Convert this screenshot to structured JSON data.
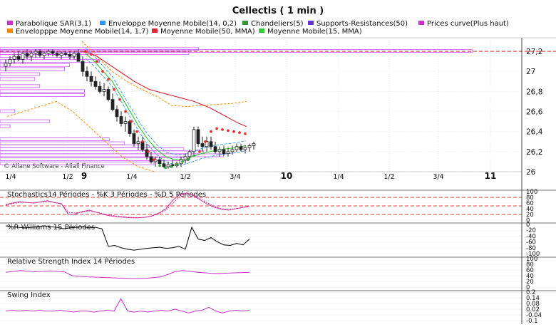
{
  "window": {
    "title": "Cellectis  ( 1 min )",
    "watermark": "© Aliane Software - Aliali Finance"
  },
  "legend": [
    {
      "label": "Parabolique SAR(3,1)",
      "color": "#cc33cc"
    },
    {
      "label": "Enveloppe Moyenne Mobile(14, 0,2)",
      "color": "#3399ff"
    },
    {
      "label": "Chandeliers(5)",
      "color": "#339933"
    },
    {
      "label": "Supports-Resistances(50)",
      "color": "#6633cc"
    },
    {
      "label": "Prices curve(Plus haut)",
      "color": "#cc33cc"
    },
    {
      "label": "Envelopppe Moyenne Mobile(14, 1,7)",
      "color": "#ff8800"
    },
    {
      "label": "Moyenne Mobile(50, MMA)",
      "color": "#dd2233"
    },
    {
      "label": "Moyenne Mobile(15, MMA)",
      "color": "#33cc33"
    }
  ],
  "colors": {
    "candle_up": "#ffffff",
    "candle_down": "#222222",
    "sr_bars": "#cc66ff",
    "sar_dots": "#ee2222",
    "stoch": "#cc3399",
    "williams": "#000000",
    "rsi": "#cc33cc",
    "swing": "#cc33cc",
    "ref_line": "#cc0000"
  },
  "chart_data": [
    {
      "type": "candlestick",
      "title": "Cellectis  ( 1 min )",
      "ylim": [
        26,
        27.3
      ],
      "y_ticks": [
        "27,2",
        "27",
        "26,8",
        "26,6",
        "26,4",
        "26,2",
        "26"
      ],
      "x_ticks": [
        "1/4",
        "1/2",
        "9",
        "1/4",
        "1/2",
        "3/4",
        "10",
        "1/4",
        "1/2",
        "3/4",
        "11"
      ],
      "resistance_line": 27.2,
      "candles_ohlc": [
        [
          27.05,
          27.12,
          27.0,
          27.08
        ],
        [
          27.08,
          27.15,
          27.05,
          27.12
        ],
        [
          27.12,
          27.18,
          27.08,
          27.15
        ],
        [
          27.15,
          27.2,
          27.1,
          27.12
        ],
        [
          27.12,
          27.2,
          27.08,
          27.18
        ],
        [
          27.18,
          27.22,
          27.12,
          27.15
        ],
        [
          27.15,
          27.2,
          27.1,
          27.18
        ],
        [
          27.18,
          27.22,
          27.14,
          27.2
        ],
        [
          27.2,
          27.22,
          27.14,
          27.16
        ],
        [
          27.16,
          27.2,
          27.12,
          27.18
        ],
        [
          27.18,
          27.22,
          27.15,
          27.2
        ],
        [
          27.2,
          27.22,
          27.15,
          27.18
        ],
        [
          27.18,
          27.2,
          27.14,
          27.16
        ],
        [
          27.16,
          27.2,
          27.12,
          27.18
        ],
        [
          27.18,
          27.2,
          27.15,
          27.17
        ],
        [
          27.17,
          27.2,
          27.12,
          27.15
        ],
        [
          27.15,
          27.2,
          27.12,
          27.18
        ],
        [
          27.18,
          27.22,
          27.12,
          27.1
        ],
        [
          27.1,
          27.15,
          26.95,
          27.0
        ],
        [
          27.0,
          27.05,
          26.9,
          26.95
        ],
        [
          26.95,
          27.0,
          26.85,
          26.9
        ],
        [
          26.9,
          26.95,
          26.82,
          26.85
        ],
        [
          26.85,
          26.9,
          26.78,
          26.8
        ],
        [
          26.8,
          26.88,
          26.75,
          26.82
        ],
        [
          26.82,
          26.85,
          26.7,
          26.72
        ],
        [
          26.72,
          26.78,
          26.6,
          26.62
        ],
        [
          26.62,
          26.66,
          26.5,
          26.55
        ],
        [
          26.55,
          26.6,
          26.45,
          26.48
        ],
        [
          26.48,
          26.55,
          26.4,
          26.5
        ],
        [
          26.5,
          26.52,
          26.35,
          26.38
        ],
        [
          26.38,
          26.42,
          26.25,
          26.28
        ],
        [
          26.28,
          26.35,
          26.22,
          26.3
        ],
        [
          26.3,
          26.35,
          26.2,
          26.22
        ],
        [
          26.22,
          26.28,
          26.12,
          26.15
        ],
        [
          26.15,
          26.2,
          26.08,
          26.1
        ],
        [
          26.1,
          26.15,
          26.05,
          26.12
        ],
        [
          26.12,
          26.15,
          26.05,
          26.08
        ],
        [
          26.08,
          26.12,
          26.04,
          26.05
        ],
        [
          26.05,
          26.1,
          26.03,
          26.07
        ],
        [
          26.07,
          26.12,
          26.04,
          26.06
        ],
        [
          26.06,
          26.1,
          26.04,
          26.08
        ],
        [
          26.08,
          26.15,
          26.05,
          26.12
        ],
        [
          26.12,
          26.18,
          26.08,
          26.15
        ],
        [
          26.15,
          26.22,
          26.12,
          26.2
        ],
        [
          26.2,
          26.45,
          26.18,
          26.42
        ],
        [
          26.42,
          26.45,
          26.25,
          26.28
        ],
        [
          26.28,
          26.35,
          26.2,
          26.25
        ],
        [
          26.25,
          26.35,
          26.2,
          26.3
        ],
        [
          26.3,
          26.35,
          26.22,
          26.25
        ],
        [
          26.25,
          26.3,
          26.18,
          26.2
        ],
        [
          26.2,
          26.25,
          26.15,
          26.22
        ],
        [
          26.22,
          26.26,
          26.16,
          26.18
        ],
        [
          26.18,
          26.24,
          26.15,
          26.2
        ],
        [
          26.2,
          26.26,
          26.17,
          26.22
        ],
        [
          26.22,
          26.28,
          26.2,
          26.25
        ],
        [
          26.25,
          26.28,
          26.2,
          26.22
        ],
        [
          26.22,
          26.26,
          26.18,
          26.24
        ],
        [
          26.24,
          26.28,
          26.2,
          26.26
        ],
        [
          26.26,
          26.3,
          26.22,
          26.28
        ]
      ],
      "ma50": [
        27.2,
        27.18,
        27.15,
        27.1,
        27.05,
        27.0,
        26.95,
        26.9,
        26.86,
        26.82,
        26.8,
        26.78,
        26.76,
        26.74,
        26.72,
        26.7,
        26.67,
        26.64,
        26.6,
        26.56,
        26.52,
        26.48,
        26.45
      ],
      "ma15": [
        27.18,
        27.1,
        27.0,
        26.9,
        26.75,
        26.6,
        26.45,
        26.32,
        26.22,
        26.15,
        26.12,
        26.12,
        26.15,
        26.18,
        26.2,
        26.22,
        26.23,
        26.24,
        26.26
      ],
      "envelope_upper_17": [
        27.3,
        27.15,
        27.0,
        26.9,
        26.82,
        26.75,
        26.66,
        26.65,
        26.66,
        26.67,
        26.68,
        26.7
      ],
      "envelope_lower_17": [
        26.55,
        26.6,
        26.65,
        26.7,
        26.6,
        26.45,
        26.3,
        26.15,
        26.05,
        26.0
      ],
      "sar": [
        27.2,
        27.17,
        27.1,
        27.0,
        26.92,
        26.82,
        26.72,
        26.6,
        26.5,
        26.4,
        26.3,
        26.2,
        26.12,
        26.06,
        26.04,
        26.05,
        26.07,
        26.1,
        26.12,
        26.16,
        26.2,
        26.3,
        26.4,
        26.43,
        26.42,
        26.41,
        26.4,
        26.39,
        26.38
      ],
      "support_resistance_bars": [
        {
          "level": 27.22,
          "length": 0.4
        },
        {
          "level": 27.2,
          "length": 0.95
        },
        {
          "level": 27.18,
          "length": 0.38
        },
        {
          "level": 27.15,
          "length": 0.15
        },
        {
          "level": 27.1,
          "length": 0.2
        },
        {
          "level": 27.06,
          "length": 0.14
        },
        {
          "level": 27.02,
          "length": 0.13
        },
        {
          "level": 26.97,
          "length": 0.08
        },
        {
          "level": 26.92,
          "length": 0.07
        },
        {
          "level": 26.85,
          "length": 0.08
        },
        {
          "level": 26.8,
          "length": 0.17
        },
        {
          "level": 26.76,
          "length": 0.17
        },
        {
          "level": 26.6,
          "length": 0.03
        },
        {
          "level": 26.5,
          "length": 0.1
        },
        {
          "level": 26.45,
          "length": 0.02
        },
        {
          "level": 26.32,
          "length": 0.22
        },
        {
          "level": 26.28,
          "length": 0.25
        },
        {
          "level": 26.25,
          "length": 0.3
        },
        {
          "level": 26.22,
          "length": 0.37
        },
        {
          "level": 26.19,
          "length": 0.41
        },
        {
          "level": 26.16,
          "length": 0.45
        },
        {
          "level": 26.12,
          "length": 0.38
        },
        {
          "level": 26.08,
          "length": 0.31
        }
      ]
    },
    {
      "type": "line",
      "title": "Stochastics14 Périodes  -  %K 3 Périodes  -  %D 5 Périodes",
      "ylim": [
        0,
        100
      ],
      "y_ticks": [
        "100",
        "80",
        "60",
        "40",
        "20",
        "0"
      ],
      "reference_levels": [
        20,
        50,
        80
      ],
      "series": [
        {
          "values": [
            55,
            60,
            65,
            62,
            60,
            64,
            68,
            62,
            58,
            20,
            22,
            30,
            35,
            28,
            20,
            15,
            12,
            10,
            8,
            8,
            10,
            15,
            25,
            40,
            70,
            90,
            95,
            85,
            70,
            55,
            45,
            38,
            35,
            40,
            45,
            48
          ]
        },
        {
          "values": [
            52,
            58,
            62,
            62,
            61,
            63,
            65,
            62,
            56,
            28,
            25,
            28,
            32,
            28,
            22,
            18,
            14,
            12,
            10,
            9,
            10,
            14,
            22,
            35,
            60,
            82,
            92,
            88,
            74,
            60,
            48,
            40,
            37,
            40,
            44,
            47
          ]
        }
      ]
    },
    {
      "type": "line",
      "title": "%R Williams 15 Périodes",
      "ylim": [
        -100,
        0
      ],
      "y_ticks": [
        "0",
        "-20",
        "-40",
        "-60",
        "-80",
        "-100"
      ],
      "series": [
        {
          "values": [
            -5,
            -8,
            -10,
            -12,
            -10,
            -8,
            -5,
            -8,
            -10,
            -15,
            -12,
            -10,
            -8,
            -12,
            -10,
            -15,
            -75,
            -72,
            -80,
            -85,
            -88,
            -85,
            -82,
            -80,
            -78,
            -82,
            -80,
            -75,
            -85,
            -10,
            -50,
            -55,
            -45,
            -60,
            -70,
            -72,
            -65,
            -70,
            -50
          ]
        }
      ]
    },
    {
      "type": "line",
      "title": "Relative Strength Index 14 Périodes",
      "ylim": [
        0,
        100
      ],
      "y_ticks": [
        "100",
        "80",
        "60",
        "40",
        "20",
        "0"
      ],
      "series": [
        {
          "values": [
            52,
            55,
            58,
            56,
            54,
            55,
            57,
            55,
            53,
            40,
            38,
            36,
            35,
            34,
            33,
            32,
            31,
            30,
            30,
            31,
            33,
            36,
            45,
            55,
            58,
            55,
            52,
            50,
            48,
            48,
            49,
            50,
            51,
            52
          ]
        }
      ]
    },
    {
      "type": "line",
      "title": "Swing Index",
      "ylim": [
        -0.1,
        0.2
      ],
      "y_ticks": [
        "0.2",
        "0.14",
        "0.08",
        "0.02",
        "-0.04",
        "-0.1"
      ],
      "series": [
        {
          "values": [
            0,
            0.01,
            0,
            0.01,
            0,
            0.01,
            0,
            0,
            0.01,
            0,
            -0.01,
            0,
            0,
            -0.01,
            0,
            0.01,
            0,
            0.13,
            0,
            -0.01,
            0,
            -0.01,
            0,
            0.01,
            0,
            0.02,
            0,
            -0.02,
            0,
            0.01,
            0.04,
            0,
            -0.02,
            0,
            0.01,
            0,
            0.01
          ]
        }
      ]
    }
  ]
}
